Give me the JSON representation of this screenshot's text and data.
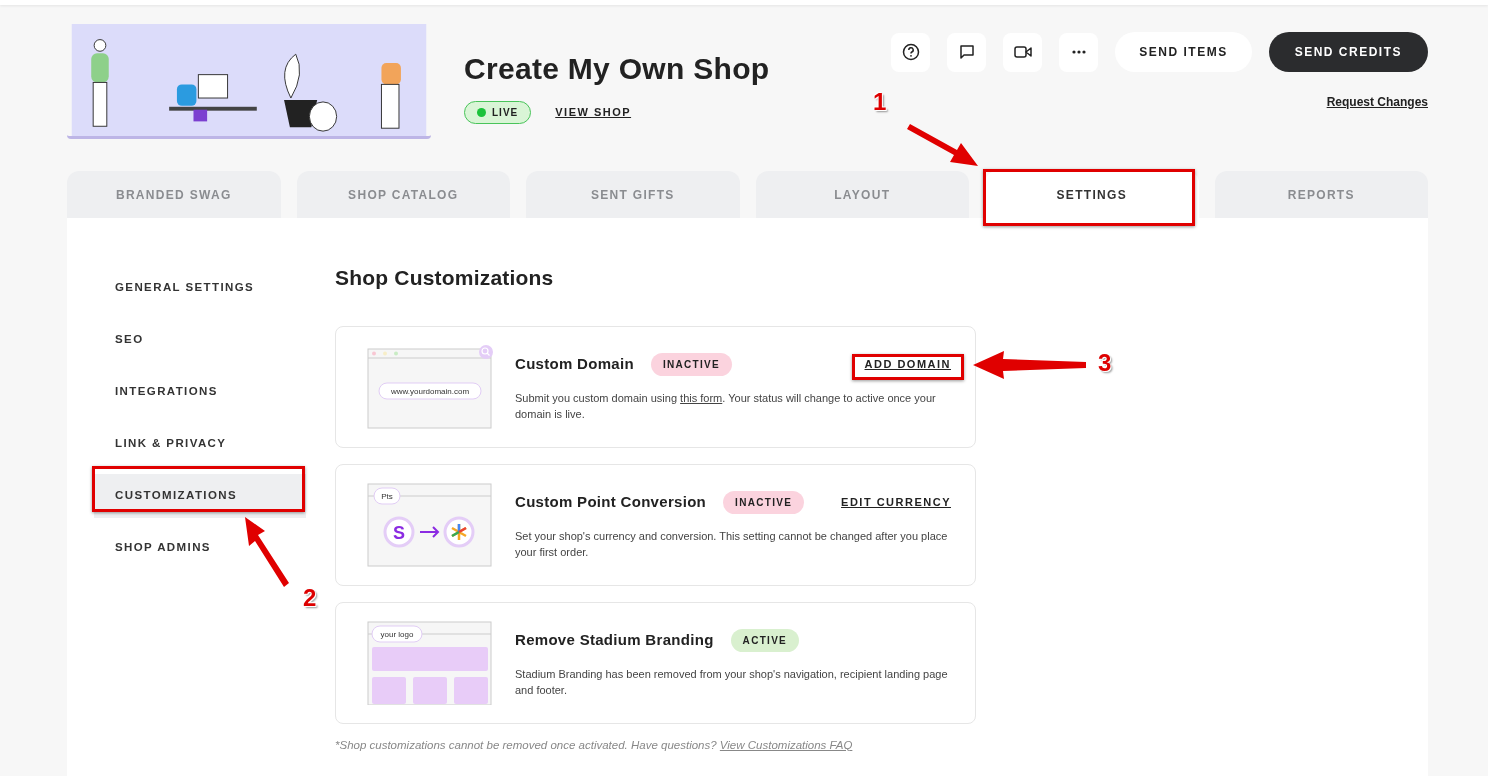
{
  "header": {
    "title": "Create My Own Shop",
    "status": {
      "label": "LIVE",
      "live": true
    },
    "view_shop": "VIEW SHOP",
    "icon_buttons": [
      {
        "kind": "help"
      },
      {
        "kind": "chat"
      },
      {
        "kind": "video"
      },
      {
        "kind": "more"
      }
    ],
    "send_items": "SEND ITEMS",
    "send_credits": "SEND CREDITS",
    "request_changes": "Request Changes"
  },
  "tabs": [
    {
      "label": "BRANDED SWAG",
      "selected": false
    },
    {
      "label": "SHOP CATALOG",
      "selected": false
    },
    {
      "label": "SENT GIFTS",
      "selected": false
    },
    {
      "label": "LAYOUT",
      "selected": false
    },
    {
      "label": "SETTINGS",
      "selected": true
    },
    {
      "label": "REPORTS",
      "selected": false
    }
  ],
  "sidebar": {
    "items": [
      {
        "label": "GENERAL SETTINGS",
        "selected": false
      },
      {
        "label": "SEO",
        "selected": false
      },
      {
        "label": "INTEGRATIONS",
        "selected": false
      },
      {
        "label": "LINK & PRIVACY",
        "selected": false
      },
      {
        "label": "CUSTOMIZATIONS",
        "selected": true
      },
      {
        "label": "SHOP ADMINS",
        "selected": false
      }
    ]
  },
  "heading": "Shop Customizations",
  "cards": [
    {
      "kind": "domain",
      "art_text": "www.yourdomain.com",
      "title": "Custom Domain",
      "status": "INACTIVE",
      "active": false,
      "action": "ADD DOMAIN",
      "desc_before": "Submit you custom domain using ",
      "desc_link": "this form",
      "desc_after": ". Your status will change to active once your domain is live."
    },
    {
      "kind": "points",
      "art_text": "Pts",
      "art_letter": "S",
      "title": "Custom Point Conversion",
      "status": "INACTIVE",
      "active": false,
      "action": "EDIT CURRENCY",
      "desc_before": "Set your shop's currency and conversion. This setting cannot be changed after you place your first order."
    },
    {
      "kind": "branding",
      "art_text": "your logo",
      "title": "Remove Stadium Branding",
      "status": "ACTIVE",
      "active": true,
      "desc_before": "Stadium Branding has been removed from your shop's navigation, recipient landing page and footer."
    }
  ],
  "footnote": {
    "text": "*Shop customizations cannot be removed once activated. Have questions?",
    "link": "View Customizations FAQ"
  },
  "annotations": [
    {
      "label": "1"
    },
    {
      "label": "2"
    },
    {
      "label": "3"
    }
  ]
}
